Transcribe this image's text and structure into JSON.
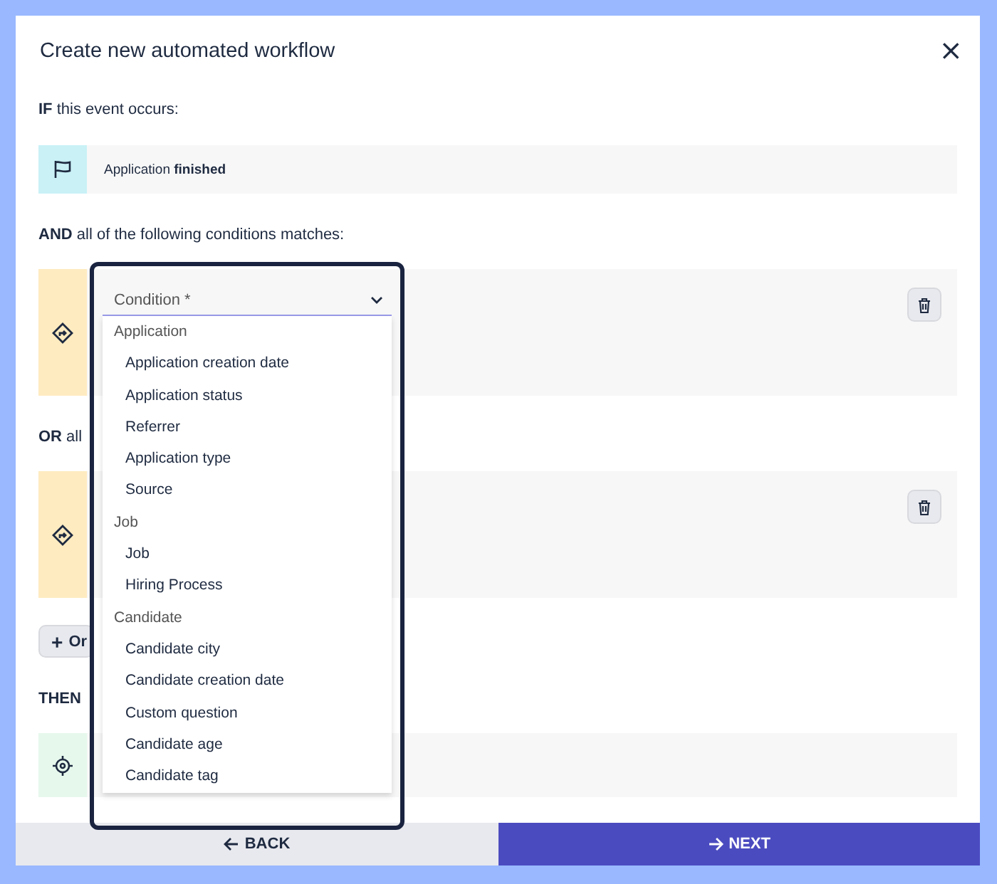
{
  "dialog": {
    "title": "Create new automated workflow",
    "close_label": "×"
  },
  "if_label": "**IF** this event occurs:",
  "event": {
    "text": "Application **finished**"
  },
  "and_label": "**AND** all of the following conditions matches:",
  "or_label": "**OR** all",
  "or_button": {
    "icon": "+",
    "label": "Or"
  },
  "then_label": "**THEN**",
  "condition_field": {
    "placeholder": "Condition *"
  },
  "options": [
    {
      "kind": "group",
      "label": "Application"
    },
    {
      "kind": "option",
      "label": "Application creation date"
    },
    {
      "kind": "option",
      "label": "Application status"
    },
    {
      "kind": "option",
      "label": "Referrer"
    },
    {
      "kind": "option",
      "label": "Application type"
    },
    {
      "kind": "option",
      "label": "Source"
    },
    {
      "kind": "group",
      "label": "Job"
    },
    {
      "kind": "option",
      "label": "Job"
    },
    {
      "kind": "option",
      "label": "Hiring Process"
    },
    {
      "kind": "group",
      "label": "Candidate"
    },
    {
      "kind": "option",
      "label": "Candidate city"
    },
    {
      "kind": "option",
      "label": "Candidate creation date"
    },
    {
      "kind": "option",
      "label": "Custom question"
    },
    {
      "kind": "option",
      "label": "Candidate age"
    },
    {
      "kind": "option",
      "label": "Candidate tag"
    }
  ],
  "footer": {
    "back": "BACK",
    "next": "NEXT"
  }
}
